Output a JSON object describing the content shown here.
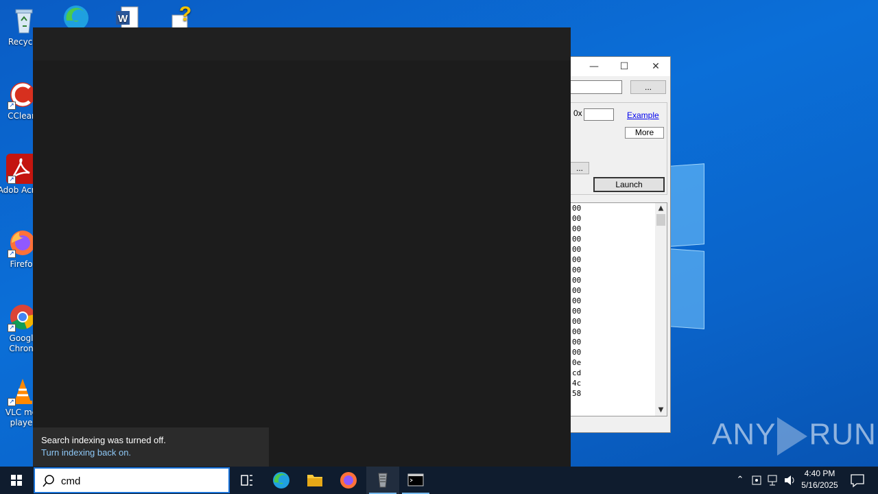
{
  "desktop": {
    "icons": [
      {
        "label": "Recycle",
        "icon": "recycle-bin-icon"
      },
      {
        "label": "",
        "icon": "edge-icon"
      },
      {
        "label": "",
        "icon": "word-document-icon"
      },
      {
        "label": "",
        "icon": "help-file-icon"
      },
      {
        "label": "CClear",
        "icon": "ccleaner-icon"
      },
      {
        "label": "Adob Acrob",
        "icon": "adobe-acrobat-icon"
      },
      {
        "label": "Firefo",
        "icon": "firefox-icon"
      },
      {
        "label": "Googl Chron",
        "icon": "chrome-icon"
      },
      {
        "label": "VLC me playe",
        "icon": "vlc-icon"
      }
    ]
  },
  "app_window": {
    "browse_label": "...",
    "hex_prefix": "0x",
    "example_link": "Example",
    "more_button": "More",
    "browse2_label": "...",
    "launch_button": "Launch",
    "hex_rows": [
      "00",
      "00",
      "00",
      "00",
      "00",
      "00",
      "00",
      "00",
      "00",
      "00",
      "00",
      "00",
      "00",
      "00",
      "00",
      "0e",
      "cd",
      "4c",
      "58"
    ]
  },
  "search": {
    "notice_title": "Search indexing was turned off.",
    "notice_link": "Turn indexing back on.",
    "query": "cmd"
  },
  "watermark": {
    "left": "ANY",
    "right": "RUN"
  },
  "taskbar": {
    "time": "4:40 PM",
    "date": "5/16/2025"
  },
  "colors": {
    "desktop_blue": "#0b6fd8",
    "taskbar": "#0f1c2e",
    "search_bg": "#1c1c1c",
    "link_blue": "#8ec8f6",
    "accent": "#1a73d9"
  }
}
